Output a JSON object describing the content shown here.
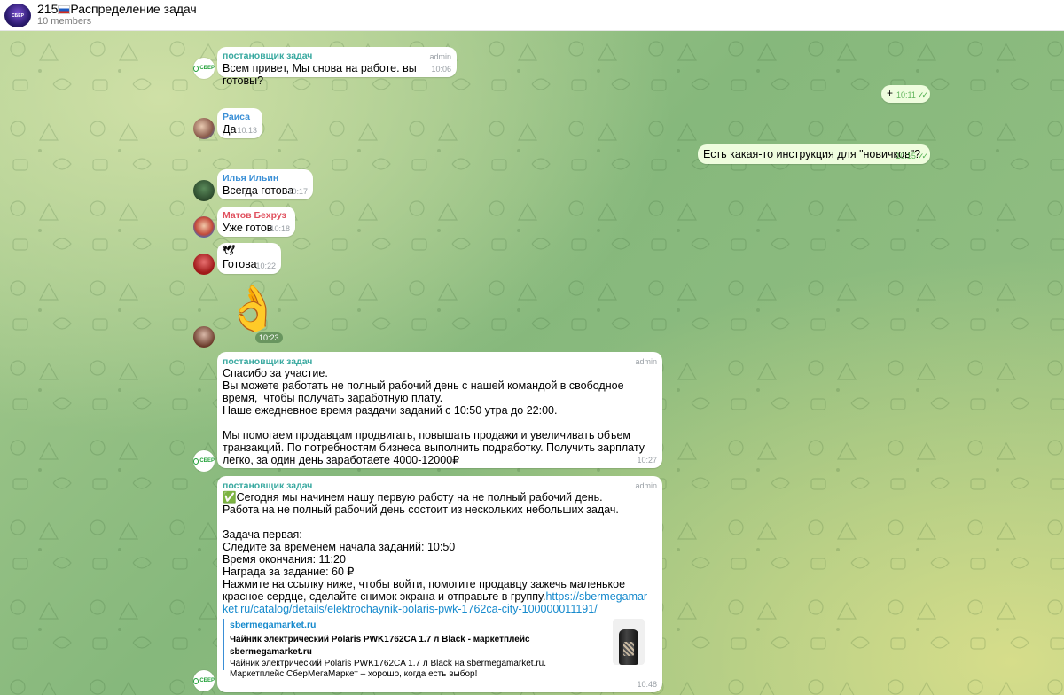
{
  "header": {
    "avatar_text": "СБЕР",
    "title_prefix": "215",
    "title": "Распределение задач",
    "members": "10 members"
  },
  "colors": {
    "sender_admin": "#39a9a0",
    "raisa": "#3a8fd6",
    "ilya": "#3a8fd6",
    "matov": "#e0505e",
    "link": "#168acd"
  },
  "messages": [
    {
      "name": "постановщик задач",
      "badge": "admin",
      "text": "Всем привет, Мы снова на работе. вы готовы?",
      "time": "10:06"
    },
    {
      "text": "+",
      "time": "10:11"
    },
    {
      "name": "Раиса",
      "text": "Да",
      "time": "10:13"
    },
    {
      "text": "Есть какая-то инструкция для \"новичков\"?",
      "time": "10:15"
    },
    {
      "name": "Илья Ильин",
      "text": "Всегда готова",
      "time": "10:17"
    },
    {
      "name": "Матов Бехруз",
      "text": "Уже готов",
      "time": "10:18"
    },
    {
      "name": "🕊",
      "text": "Готова",
      "time": "10:22"
    },
    {
      "sticker": "👌",
      "time": "10:23"
    },
    {
      "name": "постановщик задач",
      "badge": "admin",
      "text": "Спасибо за участие.\nВы можете работать не полный рабочий день с нашей командой в свободное время,  чтобы получать заработную плату.\nНаше ежедневное время раздачи заданий с 10:50 утра до 22:00.\n\nМы помогаем продавцам продвигать, повышать продажи и увеличивать объем транзакций. По потребностям бизнеса выполнить подработку. Получить зарплату  легко, за один день заработаете 4000-12000₽",
      "time": "10:27"
    },
    {
      "name": "постановщик задач",
      "badge": "admin",
      "text": "✅Сегодня мы начинем нашу первую работу на не полный рабочий день.\nРабота на не полный рабочий день состоит из нескольких небольших задач.\n\nЗадача первая:\nСледите за временем начала заданий: 10:50\nВремя окончания: 11:20\nНаграда за задание: 60 ₽\nНажмите на ссылку ниже, чтобы войти, помогите продавцу зажечь маленькое красное сердце, сделайте снимок экрана и отправьте в группу.",
      "link": "https://sbermegamarket.ru/catalog/details/elektrochaynik-polaris-pwk-1762ca-city-100000011191/",
      "preview": {
        "site": "sbermegamarket.ru",
        "title": "Чайник электрический Polaris PWK1762CA 1.7 л Black - маркетплейс sbermegamarket.ru",
        "desc": "Чайник электрический Polaris PWK1762CA 1.7 л Black на sbermegamarket.ru. Маркетплейс СберМегаМаркет – хорошо, когда есть выбор!"
      },
      "time": "10:48"
    }
  ]
}
